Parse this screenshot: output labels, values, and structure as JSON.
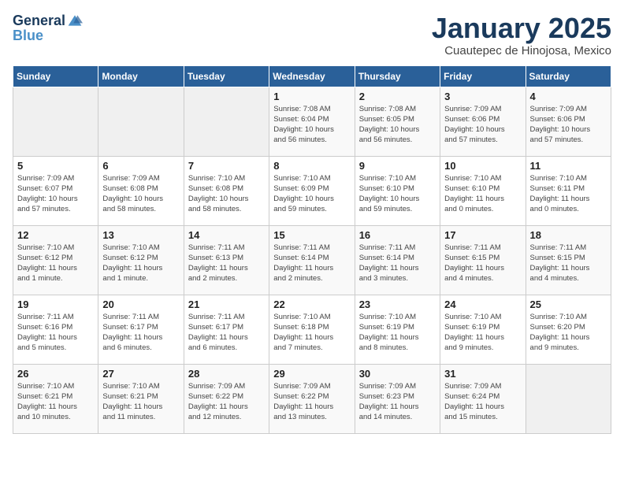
{
  "header": {
    "logo_general": "General",
    "logo_blue": "Blue",
    "title": "January 2025",
    "subtitle": "Cuautepec de Hinojosa, Mexico"
  },
  "weekdays": [
    "Sunday",
    "Monday",
    "Tuesday",
    "Wednesday",
    "Thursday",
    "Friday",
    "Saturday"
  ],
  "weeks": [
    [
      {
        "day": "",
        "info": ""
      },
      {
        "day": "",
        "info": ""
      },
      {
        "day": "",
        "info": ""
      },
      {
        "day": "1",
        "info": "Sunrise: 7:08 AM\nSunset: 6:04 PM\nDaylight: 10 hours\nand 56 minutes."
      },
      {
        "day": "2",
        "info": "Sunrise: 7:08 AM\nSunset: 6:05 PM\nDaylight: 10 hours\nand 56 minutes."
      },
      {
        "day": "3",
        "info": "Sunrise: 7:09 AM\nSunset: 6:06 PM\nDaylight: 10 hours\nand 57 minutes."
      },
      {
        "day": "4",
        "info": "Sunrise: 7:09 AM\nSunset: 6:06 PM\nDaylight: 10 hours\nand 57 minutes."
      }
    ],
    [
      {
        "day": "5",
        "info": "Sunrise: 7:09 AM\nSunset: 6:07 PM\nDaylight: 10 hours\nand 57 minutes."
      },
      {
        "day": "6",
        "info": "Sunrise: 7:09 AM\nSunset: 6:08 PM\nDaylight: 10 hours\nand 58 minutes."
      },
      {
        "day": "7",
        "info": "Sunrise: 7:10 AM\nSunset: 6:08 PM\nDaylight: 10 hours\nand 58 minutes."
      },
      {
        "day": "8",
        "info": "Sunrise: 7:10 AM\nSunset: 6:09 PM\nDaylight: 10 hours\nand 59 minutes."
      },
      {
        "day": "9",
        "info": "Sunrise: 7:10 AM\nSunset: 6:10 PM\nDaylight: 10 hours\nand 59 minutes."
      },
      {
        "day": "10",
        "info": "Sunrise: 7:10 AM\nSunset: 6:10 PM\nDaylight: 11 hours\nand 0 minutes."
      },
      {
        "day": "11",
        "info": "Sunrise: 7:10 AM\nSunset: 6:11 PM\nDaylight: 11 hours\nand 0 minutes."
      }
    ],
    [
      {
        "day": "12",
        "info": "Sunrise: 7:10 AM\nSunset: 6:12 PM\nDaylight: 11 hours\nand 1 minute."
      },
      {
        "day": "13",
        "info": "Sunrise: 7:10 AM\nSunset: 6:12 PM\nDaylight: 11 hours\nand 1 minute."
      },
      {
        "day": "14",
        "info": "Sunrise: 7:11 AM\nSunset: 6:13 PM\nDaylight: 11 hours\nand 2 minutes."
      },
      {
        "day": "15",
        "info": "Sunrise: 7:11 AM\nSunset: 6:14 PM\nDaylight: 11 hours\nand 2 minutes."
      },
      {
        "day": "16",
        "info": "Sunrise: 7:11 AM\nSunset: 6:14 PM\nDaylight: 11 hours\nand 3 minutes."
      },
      {
        "day": "17",
        "info": "Sunrise: 7:11 AM\nSunset: 6:15 PM\nDaylight: 11 hours\nand 4 minutes."
      },
      {
        "day": "18",
        "info": "Sunrise: 7:11 AM\nSunset: 6:15 PM\nDaylight: 11 hours\nand 4 minutes."
      }
    ],
    [
      {
        "day": "19",
        "info": "Sunrise: 7:11 AM\nSunset: 6:16 PM\nDaylight: 11 hours\nand 5 minutes."
      },
      {
        "day": "20",
        "info": "Sunrise: 7:11 AM\nSunset: 6:17 PM\nDaylight: 11 hours\nand 6 minutes."
      },
      {
        "day": "21",
        "info": "Sunrise: 7:11 AM\nSunset: 6:17 PM\nDaylight: 11 hours\nand 6 minutes."
      },
      {
        "day": "22",
        "info": "Sunrise: 7:10 AM\nSunset: 6:18 PM\nDaylight: 11 hours\nand 7 minutes."
      },
      {
        "day": "23",
        "info": "Sunrise: 7:10 AM\nSunset: 6:19 PM\nDaylight: 11 hours\nand 8 minutes."
      },
      {
        "day": "24",
        "info": "Sunrise: 7:10 AM\nSunset: 6:19 PM\nDaylight: 11 hours\nand 9 minutes."
      },
      {
        "day": "25",
        "info": "Sunrise: 7:10 AM\nSunset: 6:20 PM\nDaylight: 11 hours\nand 9 minutes."
      }
    ],
    [
      {
        "day": "26",
        "info": "Sunrise: 7:10 AM\nSunset: 6:21 PM\nDaylight: 11 hours\nand 10 minutes."
      },
      {
        "day": "27",
        "info": "Sunrise: 7:10 AM\nSunset: 6:21 PM\nDaylight: 11 hours\nand 11 minutes."
      },
      {
        "day": "28",
        "info": "Sunrise: 7:09 AM\nSunset: 6:22 PM\nDaylight: 11 hours\nand 12 minutes."
      },
      {
        "day": "29",
        "info": "Sunrise: 7:09 AM\nSunset: 6:22 PM\nDaylight: 11 hours\nand 13 minutes."
      },
      {
        "day": "30",
        "info": "Sunrise: 7:09 AM\nSunset: 6:23 PM\nDaylight: 11 hours\nand 14 minutes."
      },
      {
        "day": "31",
        "info": "Sunrise: 7:09 AM\nSunset: 6:24 PM\nDaylight: 11 hours\nand 15 minutes."
      },
      {
        "day": "",
        "info": ""
      }
    ]
  ]
}
